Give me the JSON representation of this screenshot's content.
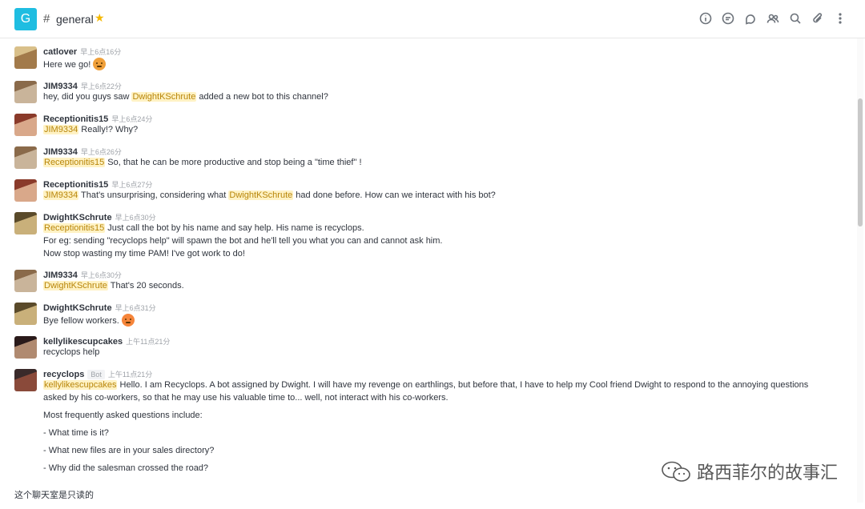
{
  "header": {
    "room_initial": "G",
    "room_name": "general",
    "star": "★",
    "icons": [
      "info-icon",
      "discussion-icon",
      "threads-icon",
      "members-icon",
      "search-icon",
      "attachment-icon",
      "kebab-icon"
    ]
  },
  "messages": [
    {
      "user": "catlover",
      "time": "早上6点16分",
      "lines": [
        [
          {
            "t": "Here we go! "
          },
          {
            "emoji": "sad"
          }
        ]
      ]
    },
    {
      "user": "JIM9334",
      "time": "早上6点22分",
      "lines": [
        [
          {
            "t": "hey, did you guys saw "
          },
          {
            "m": "DwightKSchrute"
          },
          {
            "t": " added a new bot to this channel?"
          }
        ]
      ]
    },
    {
      "user": "Receptionitis15",
      "time": "早上6点24分",
      "lines": [
        [
          {
            "m": "JIM9334"
          },
          {
            "t": " Really!? Why?"
          }
        ]
      ]
    },
    {
      "user": "JIM9334",
      "time": "早上6点26分",
      "lines": [
        [
          {
            "m": "Receptionitis15"
          },
          {
            "t": " So, that he can be more productive and stop being a \"time thief\" !"
          }
        ]
      ]
    },
    {
      "user": "Receptionitis15",
      "time": "早上6点27分",
      "lines": [
        [
          {
            "m": "JIM9334"
          },
          {
            "t": " That's unsurprising, considering what "
          },
          {
            "m": "DwightKSchrute"
          },
          {
            "t": " had done before. How can we interact with his bot?"
          }
        ]
      ]
    },
    {
      "user": "DwightKSchrute",
      "time": "早上6点30分",
      "lines": [
        [
          {
            "m": "Receptionitis15"
          },
          {
            "t": " Just call the bot by his name and say help. His name is recyclops."
          }
        ],
        [
          {
            "t": "For eg: sending \"recyclops help\" will spawn the bot and he'll tell you what you can and cannot ask him."
          }
        ],
        [
          {
            "t": "Now stop wasting my time PAM! I've got work to do!"
          }
        ]
      ]
    },
    {
      "user": "JIM9334",
      "time": "早上6点30分",
      "lines": [
        [
          {
            "m": "DwightKSchrute"
          },
          {
            "t": " That's 20 seconds."
          }
        ]
      ]
    },
    {
      "user": "DwightKSchrute",
      "time": "早上6点31分",
      "lines": [
        [
          {
            "t": "Bye fellow workers. "
          },
          {
            "emoji": "angry"
          }
        ]
      ]
    },
    {
      "user": "kellylikescupcakes",
      "time": "上午11点21分",
      "lines": [
        [
          {
            "t": "recyclops help"
          }
        ]
      ]
    },
    {
      "user": "recyclops",
      "badge": "Bot",
      "time": "上午11点21分",
      "lines": [
        [
          {
            "m": "kellylikescupcakes"
          },
          {
            "t": " Hello. I am Recyclops. A bot assigned by Dwight. I will have my revenge on earthlings, but before that, I have to help my Cool friend Dwight to respond to the annoying questions"
          }
        ],
        [
          {
            "t": "asked by his co-workers, so that he may use his valuable time to... well, not interact with his co-workers."
          }
        ],
        [
          {
            "t": "Most frequently asked questions include:"
          }
        ],
        [
          {
            "t": "- What time is it?"
          }
        ],
        [
          {
            "t": "- What new files are in your sales directory?"
          }
        ],
        [
          {
            "t": "- Why did the salesman crossed the road?"
          }
        ]
      ]
    }
  ],
  "footer": {
    "readonly_text": "这个聊天室是只读的"
  },
  "watermark": {
    "text": "路西菲尔的故事汇"
  }
}
